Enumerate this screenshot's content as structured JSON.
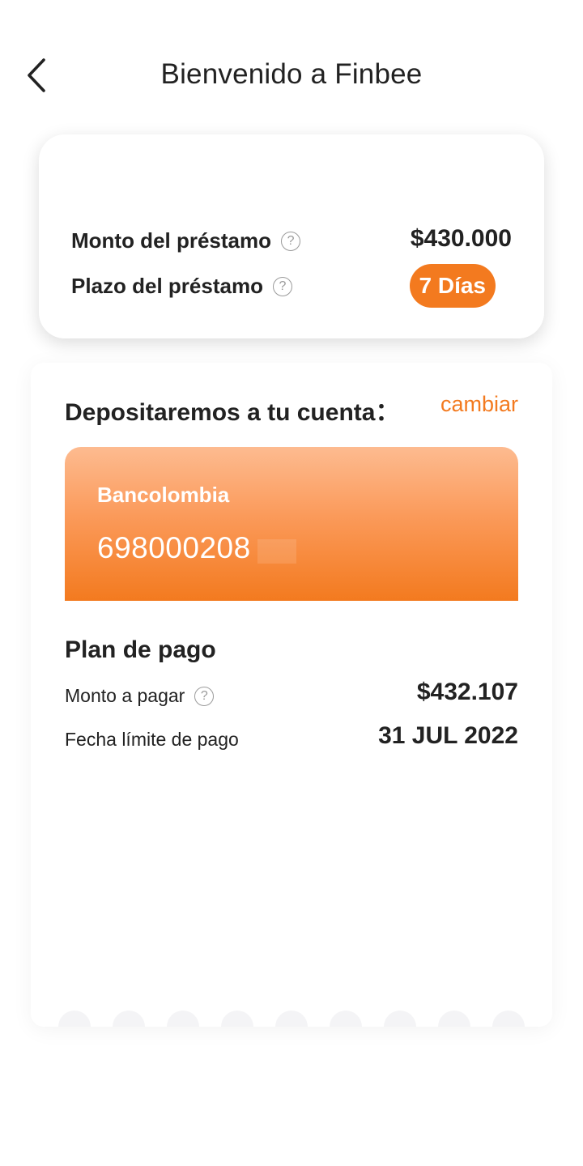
{
  "header": {
    "title": "Bienvenido a Finbee",
    "back_icon": "chevron-left-icon"
  },
  "loan": {
    "amount_label": "Monto del préstamo",
    "amount_value": "$430.000",
    "term_label": "Plazo del préstamo",
    "term_value": "7 Días",
    "help_glyph": "?"
  },
  "deposit": {
    "title": "Depositaremos a tu cuenta：",
    "change_label": "cambiar",
    "bank_name": "Bancolombia",
    "account_number": "698000208"
  },
  "plan": {
    "title": "Plan de pago",
    "amount_label": "Monto a pagar",
    "amount_value": "$432.107",
    "due_label": "Fecha límite de pago",
    "due_value": "31 JUL 2022"
  },
  "colors": {
    "accent": "#f37a1f",
    "card_gradient_top": "#fdbb90",
    "text": "#222222"
  }
}
